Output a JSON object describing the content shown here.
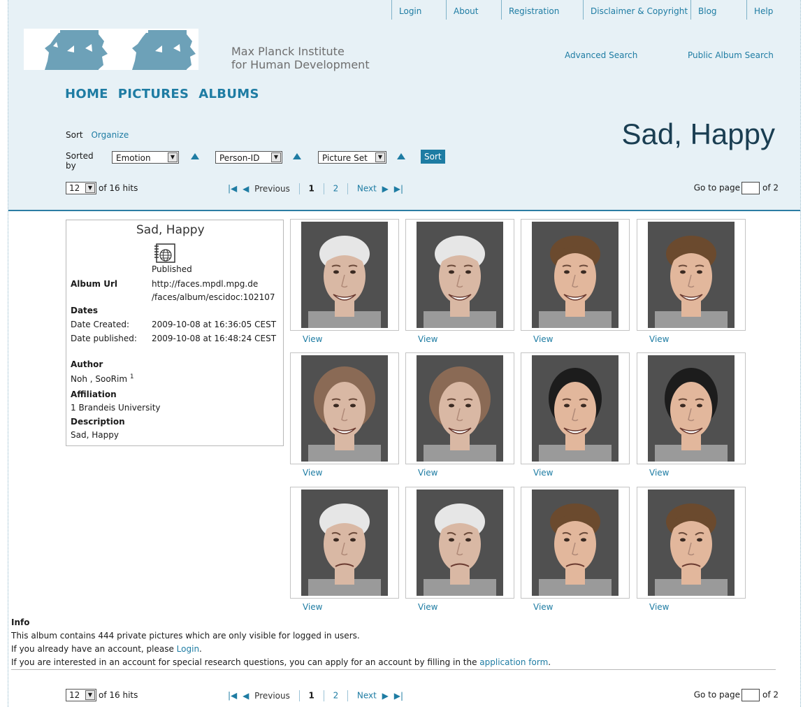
{
  "topnav": [
    "Login",
    "About",
    "Registration",
    "Disclaimer & Copyright",
    "Blog",
    "Help"
  ],
  "logo": {
    "line1": "Max Planck Institute",
    "line2": "for Human Development"
  },
  "search_links": {
    "advanced": "Advanced Search",
    "public": "Public Album Search"
  },
  "mainnav": [
    "HOME",
    "PICTURES",
    "ALBUMS"
  ],
  "album_title": "Sad, Happy",
  "sort": {
    "sort_label": "Sort",
    "organize_label": "Organize",
    "sorted_by": "Sorted by",
    "fields": [
      "Emotion",
      "Person-ID",
      "Picture Set"
    ],
    "button": "Sort"
  },
  "pager": {
    "per_page": "12",
    "hits": "of 16 hits",
    "previous": "Previous",
    "pages": [
      "1",
      "2"
    ],
    "next": "Next",
    "goto": "Go to page",
    "of_pages": "of 2"
  },
  "album": {
    "title": "Sad, Happy",
    "status": "Published",
    "url_label": "Album Url",
    "url_line1": "http://faces.mpdl.mpg.de",
    "url_line2": "/faces/album/escidoc:102107",
    "dates_label": "Dates",
    "created_label": "Date Created:",
    "created_value": "2009-10-08 at 16:36:05 CEST",
    "published_label": "Date published:",
    "published_value": "2009-10-08 at 16:48:24 CEST",
    "author_label": "Author",
    "author_value": "Noh , SooRim",
    "author_sup": "1",
    "affiliation_label": "Affiliation",
    "affiliation_value": "1 Brandeis University",
    "description_label": "Description",
    "description_value": "Sad, Happy"
  },
  "grid": {
    "view_label": "View",
    "faces": [
      {
        "type": "old-man",
        "mood": "happy"
      },
      {
        "type": "old-man",
        "mood": "happy"
      },
      {
        "type": "young-man",
        "mood": "happy"
      },
      {
        "type": "young-man",
        "mood": "happy"
      },
      {
        "type": "old-woman",
        "mood": "happy"
      },
      {
        "type": "old-woman",
        "mood": "happy"
      },
      {
        "type": "young-woman",
        "mood": "happy"
      },
      {
        "type": "young-woman",
        "mood": "happy"
      },
      {
        "type": "old-man",
        "mood": "sad"
      },
      {
        "type": "old-man",
        "mood": "sad"
      },
      {
        "type": "young-man",
        "mood": "sad"
      },
      {
        "type": "young-man",
        "mood": "sad"
      }
    ]
  },
  "info": {
    "heading": "Info",
    "line1": "This album contains 444 private pictures which are only visible for logged in users.",
    "line2_pre": "If you already have an account, please ",
    "line2_link": "Login",
    "line2_post": ".",
    "line3_pre": "If you are interested in an account for special research questions, you can apply for an account by filling in the ",
    "line3_link": "application form",
    "line3_post": "."
  },
  "colors": {
    "accent": "#1e7ca3",
    "header_bg": "#e7f1f6",
    "title": "#1a3e52"
  }
}
